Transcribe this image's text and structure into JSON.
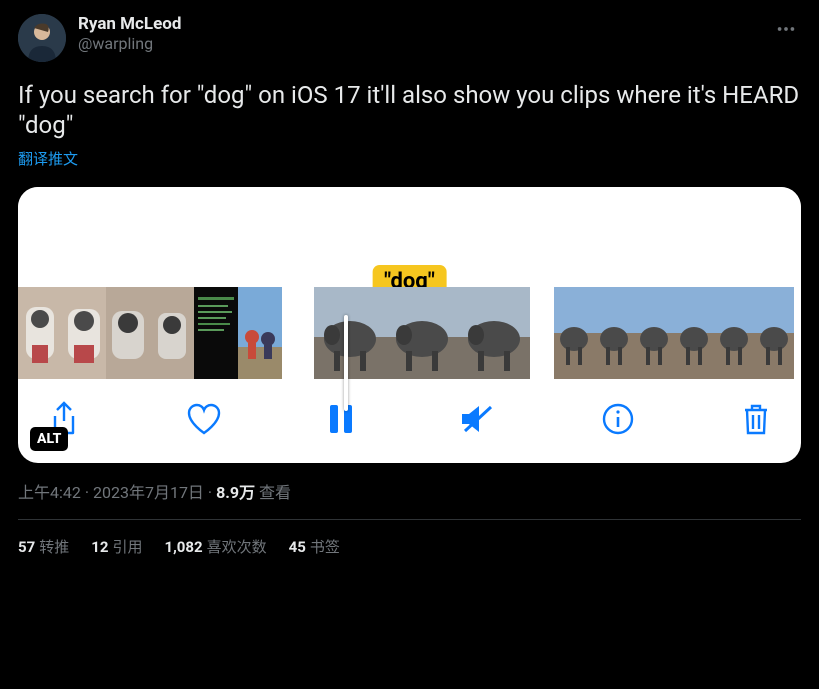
{
  "user": {
    "display_name": "Ryan McLeod",
    "handle": "@warpling"
  },
  "tweet_text": "If you search for \"dog\" on iOS 17 it'll also show you clips where it's HEARD \"dog\"",
  "translate_label": "翻译推文",
  "media": {
    "tag_label": "\"dog\"",
    "alt_badge": "ALT",
    "controls": [
      "share",
      "like",
      "pause",
      "mute",
      "info",
      "trash"
    ]
  },
  "meta": {
    "time": "上午4:42",
    "date": "2023年7月17日",
    "views_count": "8.9万",
    "views_label": "查看"
  },
  "stats": {
    "retweets_count": "57",
    "retweets_label": "转推",
    "quotes_count": "12",
    "quotes_label": "引用",
    "likes_count": "1,082",
    "likes_label": "喜欢次数",
    "bookmarks_count": "45",
    "bookmarks_label": "书签"
  }
}
